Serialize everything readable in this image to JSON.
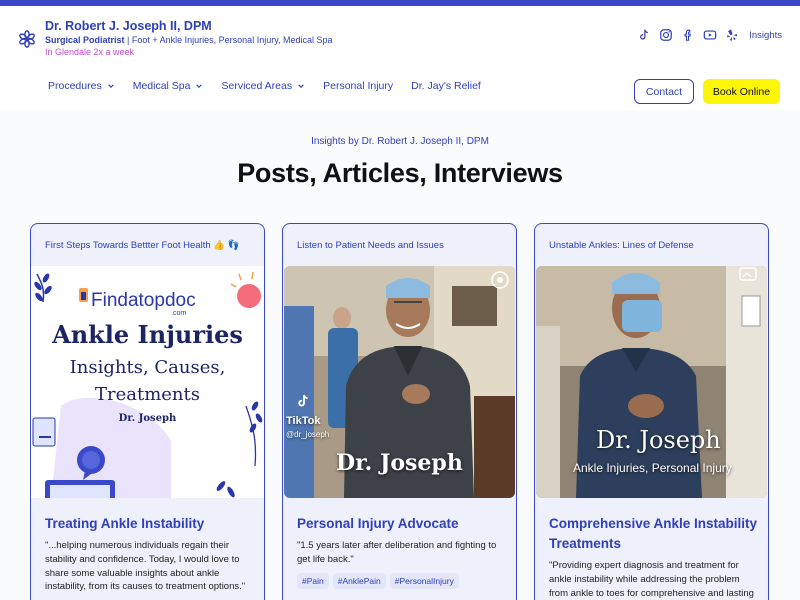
{
  "header": {
    "name": "Dr. Robert J. Joseph II, DPM",
    "subtitle_bold": "Surgical Podiatrist",
    "subtitle_rest": " | Foot + Ankle Injuries, Personal Injury, Medical Spa",
    "location": "In Glendale 2x a week",
    "insights_link": "Insights",
    "social_icons": [
      "tiktok-icon",
      "instagram-icon",
      "facebook-icon",
      "youtube-icon",
      "yelp-icon"
    ]
  },
  "nav": {
    "items": [
      {
        "label": "Procedures",
        "dropdown": true
      },
      {
        "label": "Medical Spa",
        "dropdown": true
      },
      {
        "label": "Serviced Areas",
        "dropdown": true
      },
      {
        "label": "Personal Injury",
        "dropdown": false
      },
      {
        "label": "Dr. Jay's Relief",
        "dropdown": false
      }
    ],
    "contact_label": "Contact",
    "book_label": "Book Online"
  },
  "main": {
    "eyebrow": "Insights by Dr. Robert J. Joseph II, DPM",
    "title": "Posts, Articles, Interviews"
  },
  "cards": [
    {
      "top_label": "First Steps Towards Bettter Foot Health 👍 👣",
      "media": {
        "brand": "Findatopdoc",
        "brand_sub": ".com",
        "headline": "Ankle Injuries",
        "line2": "Insights, Causes,",
        "line3": "Treatments",
        "byline": "Dr. Joseph"
      },
      "title": "Treating Ankle Instability",
      "excerpt": "\"...helping numerous individuals regain their stability and confidence. Today, I would love to share some valuable insights about ankle instability, from its causes to treatment options.\""
    },
    {
      "top_label": "Listen to Patient Needs and Issues",
      "media": {
        "platform": "TikTok",
        "handle": "@dr_joseph",
        "overlay_name": "Dr. Joseph"
      },
      "title": "Personal Injury Advocate",
      "excerpt": "\"1.5 years later after deliberation and fighting to get life back.\"",
      "tags": [
        "#Pain",
        "#AnklePain",
        "#PersonalInjury"
      ]
    },
    {
      "top_label": "Unstable Ankles: Lines of Defense",
      "media": {
        "overlay_name": "Dr. Joseph",
        "overlay_sub": "Ankle Injuries, Personal Injury"
      },
      "title": "Comprehensive Ankle Instability Treatments",
      "excerpt": "\"Providing expert diagnosis and treatment for ankle instability while addressing the problem from ankle to toes for comprehensive and lasting"
    }
  ],
  "colors": {
    "brand": "#2f3fb8",
    "accent_bar": "#3b49c9",
    "book_button": "#fcf604",
    "location_text": "#c04bd0",
    "card_bg": "#eef0fb"
  }
}
